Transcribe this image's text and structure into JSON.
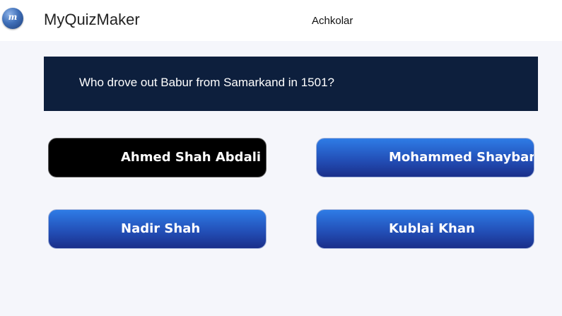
{
  "header": {
    "logo_icon": "myquizmaker-logo-icon",
    "logo_letter": "m",
    "app_title": "MyQuizMaker",
    "author": "Achkolar"
  },
  "question": {
    "text": "Who drove out Babur from Samarkand in 1501?"
  },
  "answers": [
    {
      "label": "Ahmed Shah Abdali",
      "state": "selected"
    },
    {
      "label": "Mohammed Shaybani",
      "state": "default"
    },
    {
      "label": "Nadir Shah",
      "state": "default"
    },
    {
      "label": "Kublai Khan",
      "state": "default"
    }
  ],
  "colors": {
    "question_bg": "#0d1f3d",
    "answer_gradient_top": "#2e7ce6",
    "answer_gradient_bottom": "#1a2f8a",
    "selected_answer_bg": "#000000",
    "page_bg": "#f5f6fb"
  }
}
